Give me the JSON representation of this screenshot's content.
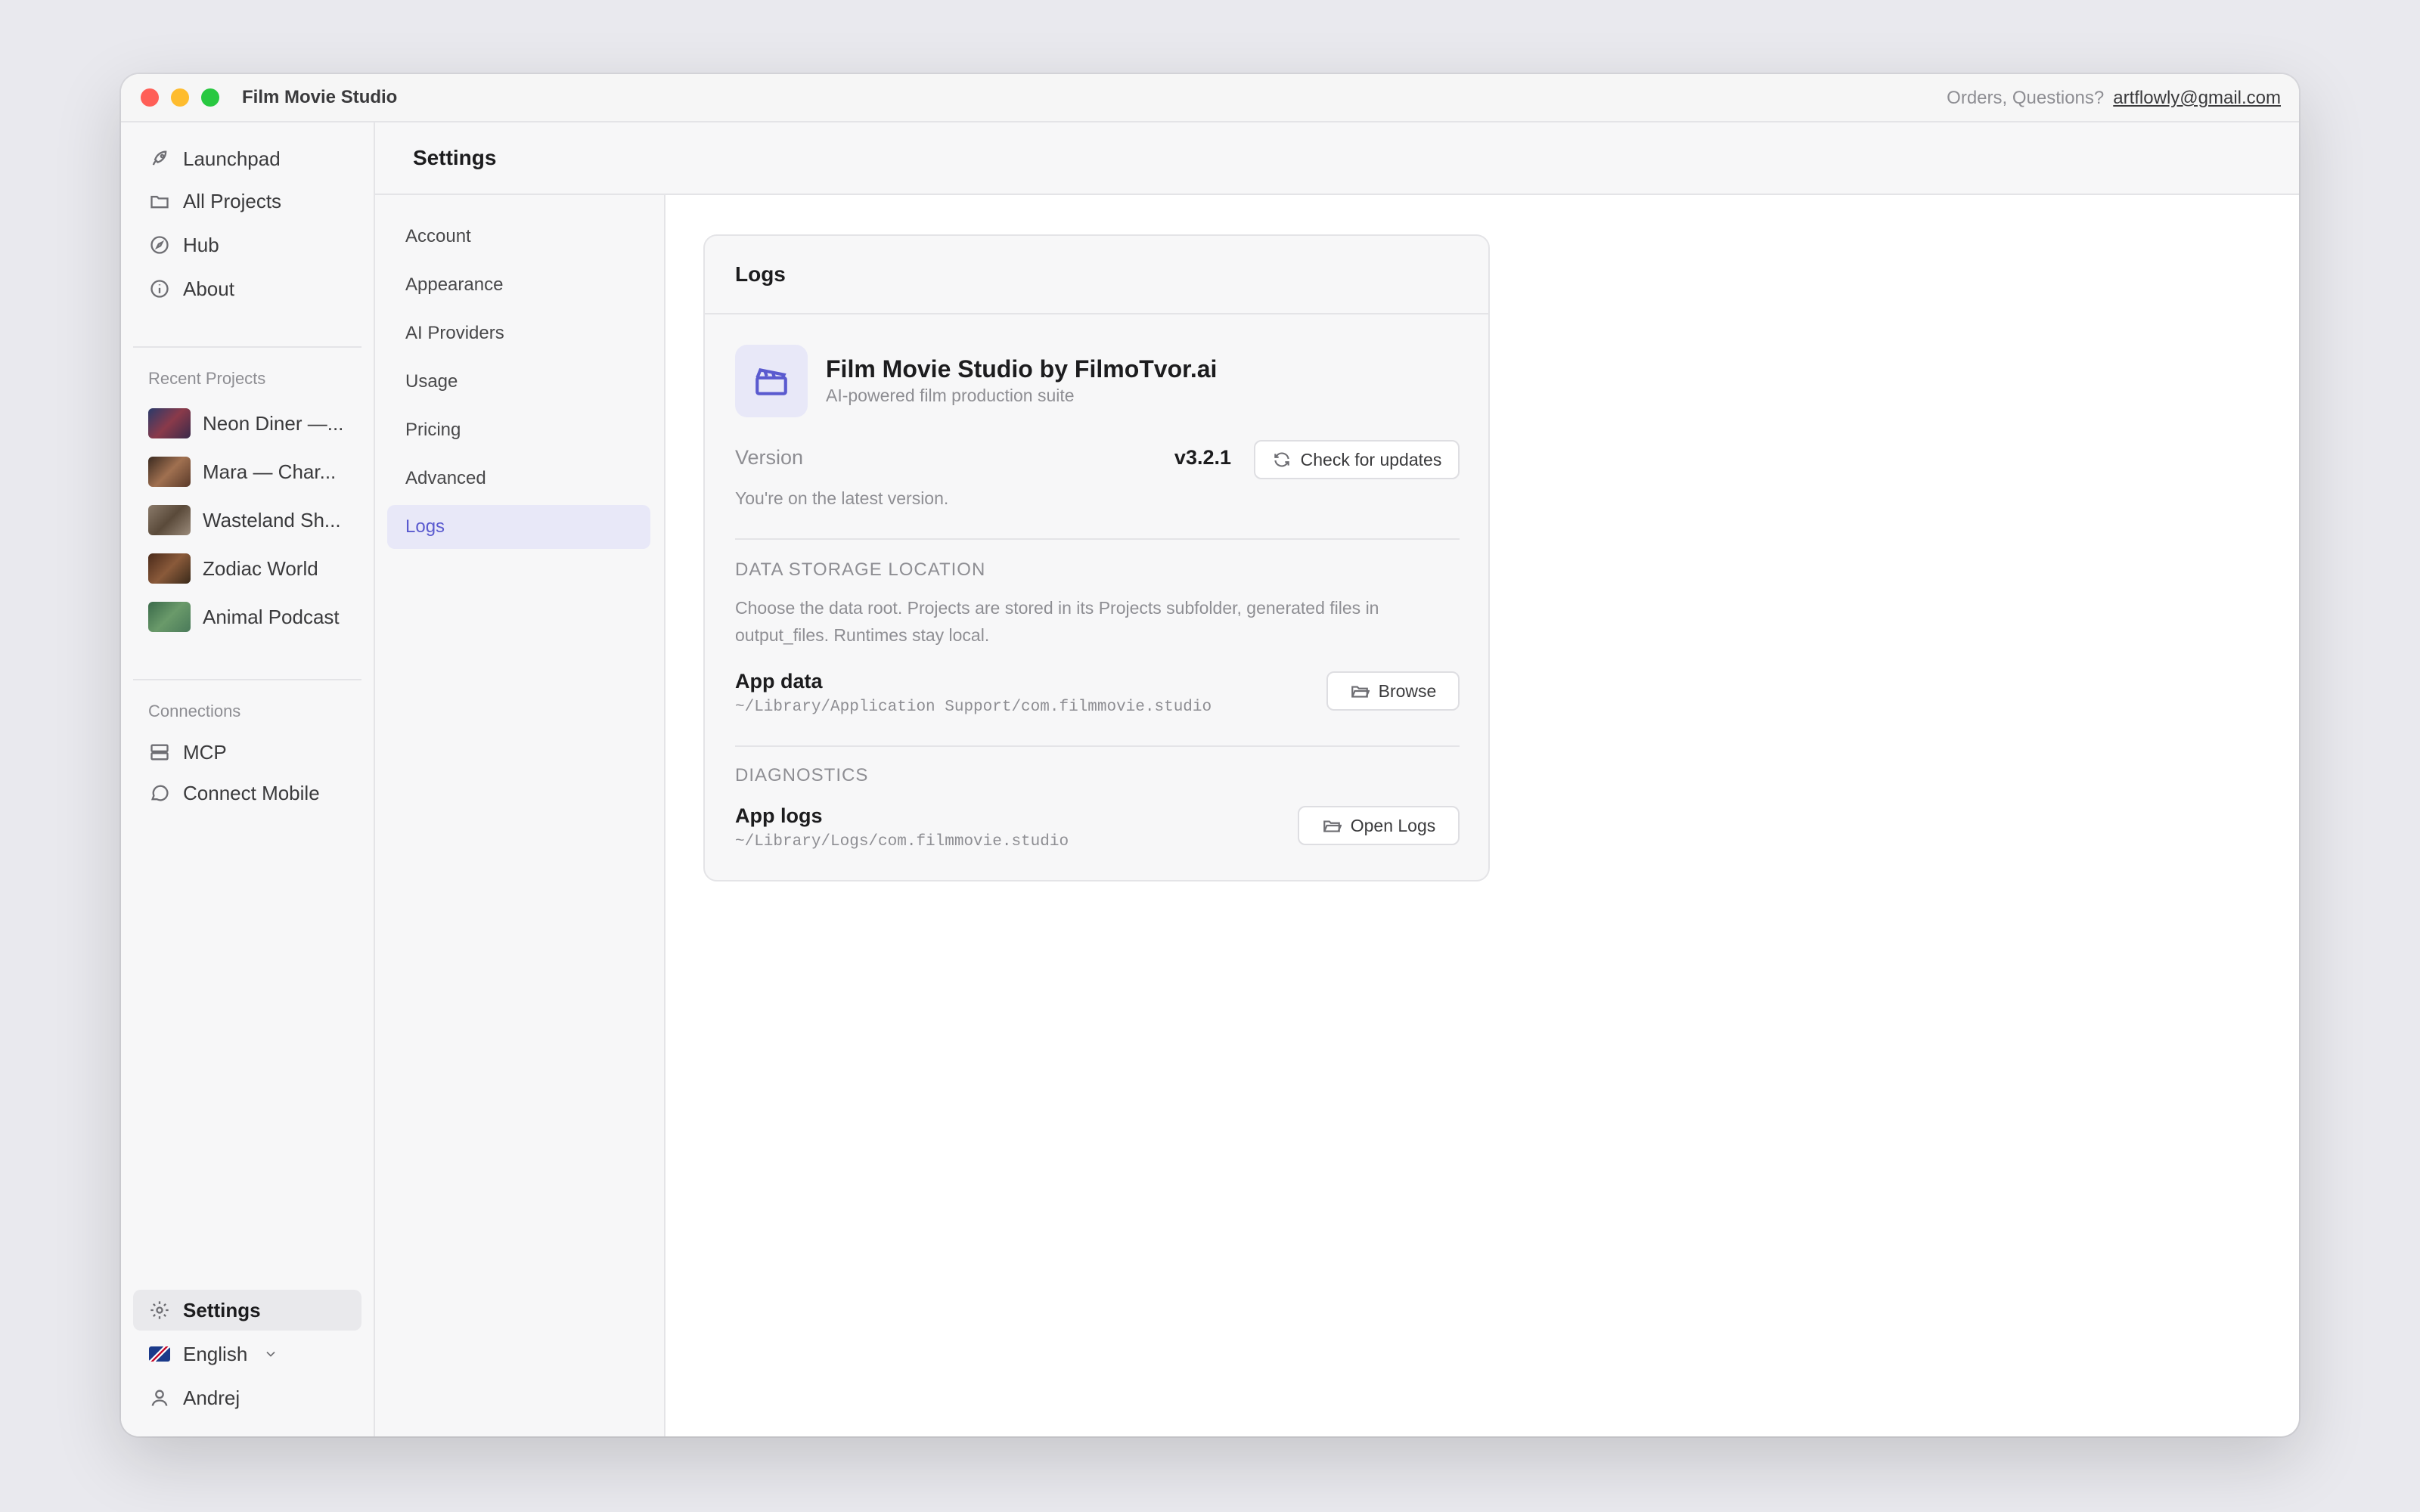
{
  "window": {
    "title": "Film Movie Studio",
    "contact_label": "Orders, Questions?",
    "contact_email": "artflowly@gmail.com"
  },
  "sidebar": {
    "nav": [
      {
        "label": "Launchpad",
        "icon": "rocket-icon"
      },
      {
        "label": "All Projects",
        "icon": "folder-icon"
      },
      {
        "label": "Hub",
        "icon": "compass-icon"
      },
      {
        "label": "About",
        "icon": "info-icon"
      }
    ],
    "recent_label": "Recent Projects",
    "recent": [
      {
        "label": "Neon Diner —...",
        "thumb_color": "#3a2a4a"
      },
      {
        "label": "Mara — Char...",
        "thumb_color": "#6a4a3a"
      },
      {
        "label": "Wasteland Sh...",
        "thumb_color": "#7a6a5a"
      },
      {
        "label": "Zodiac World",
        "thumb_color": "#5a3a2a"
      },
      {
        "label": "Animal Podcast",
        "thumb_color": "#4a7a5a"
      }
    ],
    "connections_label": "Connections",
    "connections": [
      {
        "label": "MCP",
        "icon": "server-icon"
      },
      {
        "label": "Connect Mobile",
        "icon": "message-icon"
      }
    ],
    "settings_label": "Settings",
    "language": "English",
    "user": "Andrej"
  },
  "header": {
    "title": "Settings"
  },
  "settings_menu": [
    {
      "label": "Account"
    },
    {
      "label": "Appearance"
    },
    {
      "label": "AI Providers"
    },
    {
      "label": "Usage"
    },
    {
      "label": "Pricing"
    },
    {
      "label": "Advanced"
    },
    {
      "label": "Logs",
      "active": true
    }
  ],
  "card": {
    "title": "Logs",
    "app_name": "Film Movie Studio by FilmoTvor.ai",
    "app_subtitle": "AI-powered film production suite",
    "version_label": "Version",
    "version": "v3.2.1",
    "check_updates": "Check for updates",
    "latest_text": "You're on the latest version.",
    "storage_title": "DATA STORAGE LOCATION",
    "storage_desc": "Choose the data root. Projects are stored in its Projects subfolder, generated files in output_files. Runtimes stay local.",
    "app_data_label": "App data",
    "app_data_path": "~/Library/Application Support/com.filmmovie.studio",
    "browse": "Browse",
    "diagnostics_title": "DIAGNOSTICS",
    "app_logs_label": "App logs",
    "app_logs_path": "~/Library/Logs/com.filmmovie.studio",
    "open_logs": "Open Logs"
  },
  "colors": {
    "accent": "#5a5acf",
    "accent_bg": "#e8e8f8"
  }
}
